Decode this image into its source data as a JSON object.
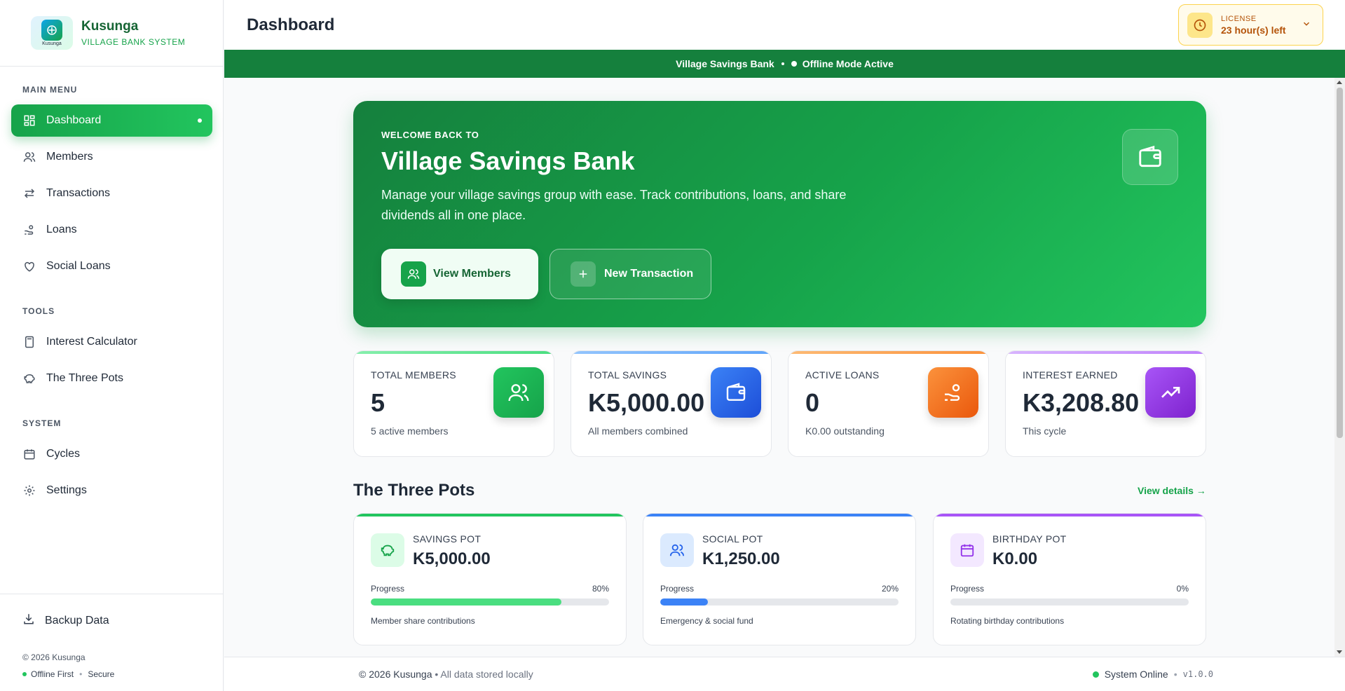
{
  "brand": {
    "name": "Kusunga",
    "subtitle": "VILLAGE BANK SYSTEM",
    "logo_text": "Kusunga"
  },
  "sidebar": {
    "main_menu_label": "MAIN MENU",
    "main_items": [
      {
        "label": "Dashboard",
        "icon": "dashboard-icon",
        "active": true
      },
      {
        "label": "Members",
        "icon": "users-icon"
      },
      {
        "label": "Transactions",
        "icon": "transfer-icon"
      },
      {
        "label": "Loans",
        "icon": "hand-coins-icon"
      },
      {
        "label": "Social Loans",
        "icon": "heart-icon"
      }
    ],
    "tools_label": "TOOLS",
    "tools_items": [
      {
        "label": "Interest Calculator",
        "icon": "calculator-icon"
      },
      {
        "label": "The Three Pots",
        "icon": "piggy-bank-icon"
      }
    ],
    "system_label": "SYSTEM",
    "system_items": [
      {
        "label": "Cycles",
        "icon": "calendar-icon"
      },
      {
        "label": "Settings",
        "icon": "gear-icon"
      }
    ],
    "backup_label": "Backup Data",
    "copyright": "© 2026 Kusunga",
    "flag_offline": "Offline First",
    "flag_secure": "Secure"
  },
  "header": {
    "title": "Dashboard",
    "license_label": "LICENSE",
    "license_value": "23 hour(s) left"
  },
  "banner": {
    "bank_name": "Village Savings Bank",
    "mode": "Offline Mode Active"
  },
  "hero": {
    "eyebrow": "WELCOME BACK TO",
    "title": "Village Savings Bank",
    "description": "Manage your village savings group with ease. Track contributions, loans, and share dividends all in one place.",
    "primary_button": "View Members",
    "secondary_button": "New Transaction"
  },
  "stats": [
    {
      "label": "TOTAL MEMBERS",
      "value": "5",
      "sub": "5 active members",
      "icon": "users-icon",
      "color": "#16a34a"
    },
    {
      "label": "TOTAL SAVINGS",
      "value": "K5,000.00",
      "sub": "All members combined",
      "icon": "wallet-icon",
      "color": "#2563eb"
    },
    {
      "label": "ACTIVE LOANS",
      "value": "0",
      "sub": "K0.00 outstanding",
      "icon": "hand-coins-icon",
      "color": "#f97316"
    },
    {
      "label": "INTEREST EARNED",
      "value": "K3,208.80",
      "sub": "This cycle",
      "icon": "trending-up-icon",
      "color": "#9333ea"
    }
  ],
  "pots_section": {
    "title": "The Three Pots",
    "view_details": "View details →"
  },
  "pots": [
    {
      "label": "SAVINGS POT",
      "value": "K5,000.00",
      "progress_label": "Progress",
      "progress": 80,
      "progress_text": "80%",
      "description": "Member share contributions",
      "icon": "piggy-bank-icon",
      "color": "#22c55e"
    },
    {
      "label": "SOCIAL POT",
      "value": "K1,250.00",
      "progress_label": "Progress",
      "progress": 20,
      "progress_text": "20%",
      "description": "Emergency & social fund",
      "icon": "users-icon",
      "color": "#3b82f6"
    },
    {
      "label": "BIRTHDAY POT",
      "value": "K0.00",
      "progress_label": "Progress",
      "progress": 0,
      "progress_text": "0%",
      "description": "Rotating birthday contributions",
      "icon": "calendar-icon",
      "color": "#a855f7"
    }
  ],
  "footer": {
    "copyright": "© 2026 Kusunga",
    "storage_note": "• All data stored locally",
    "status": "System Online",
    "version": "v1.0.0"
  }
}
